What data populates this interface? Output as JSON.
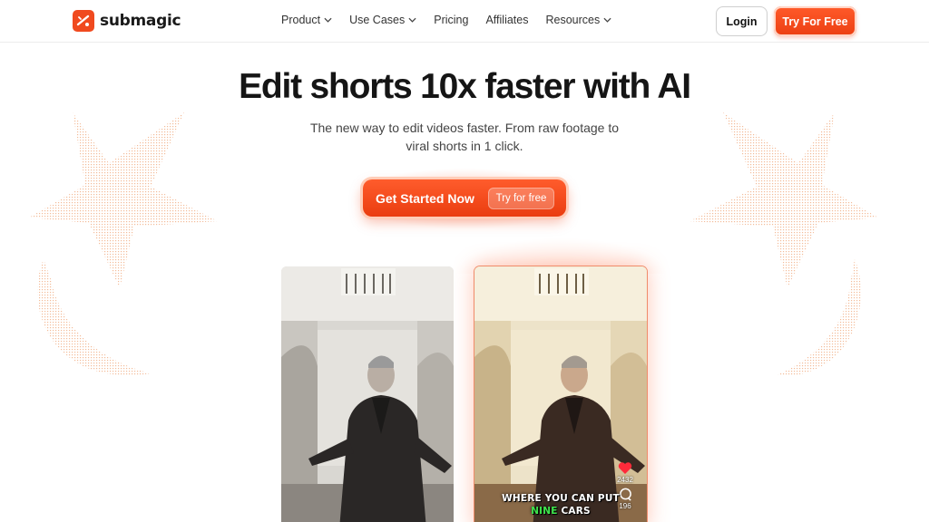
{
  "brand": {
    "name": "submagic",
    "accent": "#f04a1f"
  },
  "nav": {
    "items": [
      {
        "label": "Product",
        "dropdown": true
      },
      {
        "label": "Use Cases",
        "dropdown": true
      },
      {
        "label": "Pricing",
        "dropdown": false
      },
      {
        "label": "Affiliates",
        "dropdown": false
      },
      {
        "label": "Resources",
        "dropdown": true
      }
    ],
    "login_label": "Login",
    "try_label": "Try For Free"
  },
  "hero": {
    "headline": "Edit shorts 10x faster with AI",
    "subline_1": "The new way to edit videos faster. From raw footage to",
    "subline_2": "viral shorts in 1 click.",
    "cta_label": "Get Started Now",
    "cta_chip": "Try for free"
  },
  "video_after": {
    "caption_line1": "WHERE YOU CAN PUT",
    "caption_highlight": "NINE",
    "caption_rest": " CARS",
    "likes": "2432",
    "comments": "196"
  }
}
